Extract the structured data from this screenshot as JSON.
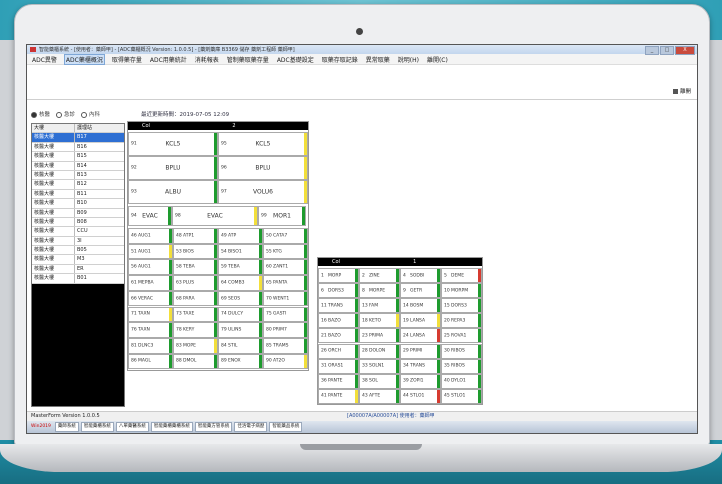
{
  "window": {
    "title": "智能藥櫃系統 - [使用者：藥師甲] - [ADC藥櫃概況 Version: 1.0.0.5] - [藥劑藥庫 B3369 儲存 藥劑工程師 藥師甲]",
    "controls": [
      "_",
      "□",
      "X"
    ]
  },
  "menu": [
    "ADC異警",
    "ADC藥櫃概況",
    "取得藥存量",
    "ADC用藥統計",
    "消耗報表",
    "管制藥取藥存量",
    "ADC基礎設定",
    "取藥存取記錄",
    "異常取藥",
    "說明(H)",
    "離開(C)"
  ],
  "toolbar": {
    "exit_label": "離開"
  },
  "left": {
    "radio_options": [
      "核醫",
      "急診",
      "內科"
    ],
    "radio_selected_index": 0,
    "columns": [
      "大樓",
      "護理站"
    ],
    "rows": [
      [
        "核醫大樓",
        "B17"
      ],
      [
        "核醫大樓",
        "B16"
      ],
      [
        "核醫大樓",
        "B15"
      ],
      [
        "核醫大樓",
        "B14"
      ],
      [
        "核醫大樓",
        "B13"
      ],
      [
        "核醫大樓",
        "B12"
      ],
      [
        "核醫大樓",
        "B11"
      ],
      [
        "核醫大樓",
        "B10"
      ],
      [
        "核醫大樓",
        "B09"
      ],
      [
        "核醫大樓",
        "B08"
      ],
      [
        "核醫大樓",
        "CCU"
      ],
      [
        "核醫大樓",
        "3I"
      ],
      [
        "核醫大樓",
        "B05"
      ],
      [
        "核醫大樓",
        "M3"
      ],
      [
        "核醫大樓",
        "ER"
      ],
      [
        "核醫大樓",
        "B01"
      ]
    ],
    "selected_index": 0
  },
  "main": {
    "update_label": "最近更新時間：2019-07-05 12:09",
    "panel1": {
      "header": [
        "Col",
        "2"
      ],
      "big": [
        {
          "no": "91",
          "name": "KCL5",
          "bar": "#1e9b2e"
        },
        {
          "no": "95",
          "name": "KCL5",
          "bar": "#f2df3a"
        },
        {
          "no": "92",
          "name": "BPLU",
          "bar": "#1e9b2e"
        },
        {
          "no": "96",
          "name": "BPLU",
          "bar": "#f2df3a"
        },
        {
          "no": "93",
          "name": "ALBU",
          "bar": "#1e9b2e"
        },
        {
          "no": "97",
          "name": "VOLU6",
          "bar": "#f2df3a"
        }
      ],
      "mid": [
        {
          "no": "94",
          "name": "EVAC",
          "bar": "#1e9b2e"
        },
        {
          "no": "98",
          "name": "EVAC",
          "bar": "#f2df3a"
        },
        {
          "no": "99",
          "name": "MOR1",
          "bar": "#1e9b2e"
        }
      ],
      "rows": [
        [
          {
            "no": "46",
            "name": "AUG1",
            "bar": "#1e9b2e"
          },
          {
            "no": "48",
            "name": "ATP1",
            "bar": "#1e9b2e"
          },
          {
            "no": "49",
            "name": "ATP",
            "bar": "#1e9b2e"
          },
          {
            "no": "50",
            "name": "CATA7",
            "bar": "#1e9b2e"
          }
        ],
        [
          {
            "no": "51",
            "name": "AUG1",
            "bar": "#f2df3a"
          },
          {
            "no": "53",
            "name": "BIOS",
            "bar": "#1e9b2e"
          },
          {
            "no": "54",
            "name": "BISO1",
            "bar": "#1e9b2e"
          },
          {
            "no": "55",
            "name": "KTG",
            "bar": "#1e9b2e"
          }
        ],
        [
          {
            "no": "56",
            "name": "AUG1",
            "bar": "#1e9b2e"
          },
          {
            "no": "58",
            "name": "TEBA",
            "bar": "#1e9b2e"
          },
          {
            "no": "59",
            "name": "TEBA",
            "bar": "#1e9b2e"
          },
          {
            "no": "60",
            "name": "ZANT1",
            "bar": "#1e9b2e"
          }
        ],
        [
          {
            "no": "61",
            "name": "MEPBA",
            "bar": "#1e9b2e"
          },
          {
            "no": "63",
            "name": "PLUS",
            "bar": "#1e9b2e"
          },
          {
            "no": "64",
            "name": "COMB3",
            "bar": "#f2df3a"
          },
          {
            "no": "65",
            "name": "PANTA",
            "bar": "#1e9b2e"
          }
        ],
        [
          {
            "no": "66",
            "name": "VERAC",
            "bar": "#1e9b2e"
          },
          {
            "no": "68",
            "name": "PARA",
            "bar": "#1e9b2e"
          },
          {
            "no": "69",
            "name": "SEOS",
            "bar": "#1e9b2e"
          },
          {
            "no": "70",
            "name": "WENT1",
            "bar": "#1e9b2e"
          }
        ],
        [
          {
            "no": "71",
            "name": "TAXN",
            "bar": "#f2df3a"
          },
          {
            "no": "73",
            "name": "TAXE",
            "bar": "#1e9b2e"
          },
          {
            "no": "74",
            "name": "DULCY",
            "bar": "#1e9b2e"
          },
          {
            "no": "75",
            "name": "GASTI",
            "bar": "#1e9b2e"
          }
        ],
        [
          {
            "no": "76",
            "name": "TAXN",
            "bar": "#1e9b2e"
          },
          {
            "no": "78",
            "name": "KERY",
            "bar": "#1e9b2e"
          },
          {
            "no": "79",
            "name": "ULINS",
            "bar": "#1e9b2e"
          },
          {
            "no": "80",
            "name": "PRIM7",
            "bar": "#1e9b2e"
          }
        ],
        [
          {
            "no": "81",
            "name": "DLNC3",
            "bar": "#1e9b2e"
          },
          {
            "no": "83",
            "name": "MOPE",
            "bar": "#f2df3a"
          },
          {
            "no": "84",
            "name": "STIL",
            "bar": "#1e9b2e"
          },
          {
            "no": "85",
            "name": "TRAMS",
            "bar": "#1e9b2e"
          }
        ],
        [
          {
            "no": "86",
            "name": "MAGL",
            "bar": "#1e9b2e"
          },
          {
            "no": "88",
            "name": "DMOL",
            "bar": "#1e9b2e"
          },
          {
            "no": "89",
            "name": "ENOX",
            "bar": "#1e9b2e"
          },
          {
            "no": "90",
            "name": "AT2O",
            "bar": "#f2df3a"
          }
        ]
      ]
    },
    "panel2": {
      "header": [
        "Col",
        "1"
      ],
      "rows": [
        [
          {
            "no": "1",
            "name": "MORP",
            "bar": "#1e9b2e"
          },
          {
            "no": "2",
            "name": "ZINE",
            "bar": "#1e9b2e"
          },
          {
            "no": "4",
            "name": "SODBI",
            "bar": "#1e9b2e"
          },
          {
            "no": "5",
            "name": "DEME",
            "bar": "#d63b30"
          }
        ],
        [
          {
            "no": "6",
            "name": "DORS3",
            "bar": "#1e9b2e"
          },
          {
            "no": "8",
            "name": "MORPE",
            "bar": "#1e9b2e"
          },
          {
            "no": "9",
            "name": "GETR",
            "bar": "#1e9b2e"
          },
          {
            "no": "10",
            "name": "MORPM",
            "bar": "#1e9b2e"
          }
        ],
        [
          {
            "no": "11",
            "name": "TRAN5",
            "bar": "#1e9b2e"
          },
          {
            "no": "13",
            "name": "FAM",
            "bar": "#1e9b2e"
          },
          {
            "no": "14",
            "name": "BOSM",
            "bar": "#1e9b2e"
          },
          {
            "no": "15",
            "name": "DORS3",
            "bar": "#1e9b2e"
          }
        ],
        [
          {
            "no": "16",
            "name": "BAZO",
            "bar": "#1e9b2e"
          },
          {
            "no": "18",
            "name": "KETO",
            "bar": "#f2df3a"
          },
          {
            "no": "19",
            "name": "LANSA",
            "bar": "#f2df3a"
          },
          {
            "no": "20",
            "name": "REPA3",
            "bar": "#1e9b2e"
          }
        ],
        [
          {
            "no": "21",
            "name": "BAZO",
            "bar": "#1e9b2e"
          },
          {
            "no": "23",
            "name": "PRIMA",
            "bar": "#1e9b2e"
          },
          {
            "no": "24",
            "name": "LANSA",
            "bar": "#d63b30"
          },
          {
            "no": "25",
            "name": "ROVA1",
            "bar": "#1e9b2e"
          }
        ],
        [
          {
            "no": "26",
            "name": "ORCH",
            "bar": "#1e9b2e"
          },
          {
            "no": "28",
            "name": "DOLON",
            "bar": "#1e9b2e"
          },
          {
            "no": "29",
            "name": "PRIMI",
            "bar": "#1e9b2e"
          },
          {
            "no": "30",
            "name": "RIBOS",
            "bar": "#1e9b2e"
          }
        ],
        [
          {
            "no": "31",
            "name": "ORAS1",
            "bar": "#1e9b2e"
          },
          {
            "no": "33",
            "name": "SOLN1",
            "bar": "#1e9b2e"
          },
          {
            "no": "34",
            "name": "TRANS",
            "bar": "#1e9b2e"
          },
          {
            "no": "35",
            "name": "RIBOS",
            "bar": "#1e9b2e"
          }
        ],
        [
          {
            "no": "36",
            "name": "PANTE",
            "bar": "#1e9b2e"
          },
          {
            "no": "38",
            "name": "SOL",
            "bar": "#1e9b2e"
          },
          {
            "no": "39",
            "name": "ZOPI1",
            "bar": "#1e9b2e"
          },
          {
            "no": "40",
            "name": "DYLO1",
            "bar": "#1e9b2e"
          }
        ],
        [
          {
            "no": "41",
            "name": "PANTE",
            "bar": "#f2df3a"
          },
          {
            "no": "43",
            "name": "AFTE",
            "bar": "#1e9b2e"
          },
          {
            "no": "44",
            "name": "STLO1",
            "bar": "#d63b30"
          },
          {
            "no": "45",
            "name": "STLO1",
            "bar": "#1e9b2e"
          }
        ]
      ]
    }
  },
  "status": {
    "left": "MasterForm  Version 1.0.0.5",
    "right": "[A00007A/A00007A]  使用者：藥師甲"
  },
  "taskbar": [
    "Win2019",
    "藥師系統",
    "智能藥櫃系統",
    "八單藥醫系統",
    "智能藥櫃藥櫃系統",
    "智能藥方管系統",
    "佳洛電子病歷",
    "智能藥品系統"
  ]
}
